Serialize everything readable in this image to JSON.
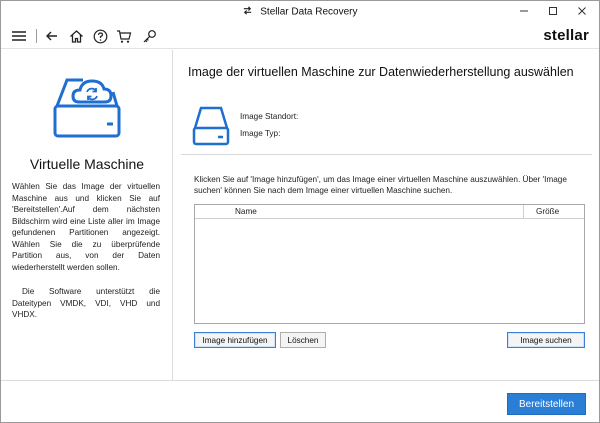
{
  "window": {
    "title": "Stellar Data Recovery",
    "title_icon": "recovery-arrows-icon",
    "controls": [
      "minimize-icon",
      "maximize-icon",
      "close-icon"
    ]
  },
  "toolbar": {
    "icons": [
      "hamburger-menu-icon",
      "back-arrow-icon",
      "home-icon",
      "help-icon",
      "cart-icon",
      "key-icon"
    ],
    "brand": "stellar"
  },
  "left_panel": {
    "icon": "virtual-drive-cloud-icon",
    "title": "Virtuelle Maschine",
    "description": "Wählen Sie das Image der virtuellen Maschine aus und klicken Sie auf 'Bereitstellen'.Auf dem nächsten Bildschirm wird eine Liste aller im Image gefundenen Partitionen angezeigt. Wählen Sie die zu überprüfende Partition aus, von der Daten wiederherstellt werden sollen.",
    "supported": "Die Software unterstützt die Dateitypen VMDK, VDI, VHD und VHDX."
  },
  "main": {
    "title": "Image der virtuellen Maschine zur Datenwiederherstellung auswählen",
    "drive_icon": "hard-drive-icon",
    "image_location_label": "Image Standort:",
    "image_type_label": "Image Typ:",
    "instruction": "Klicken Sie auf 'Image  hinzufügen', um das Image einer virtuellen Maschine auszuwählen. Über 'Image suchen' können Sie nach dem Image einer virtuellen Maschine suchen.",
    "table": {
      "columns": [
        "Name",
        "Größe"
      ],
      "rows": []
    },
    "buttons": {
      "add": "Image hinzufügen",
      "delete": "Löschen",
      "search": "Image suchen"
    }
  },
  "footer": {
    "deploy": "Bereitstellen"
  },
  "colors": {
    "accent": "#2a7ed6",
    "icon_blue": "#1e6fd0"
  }
}
